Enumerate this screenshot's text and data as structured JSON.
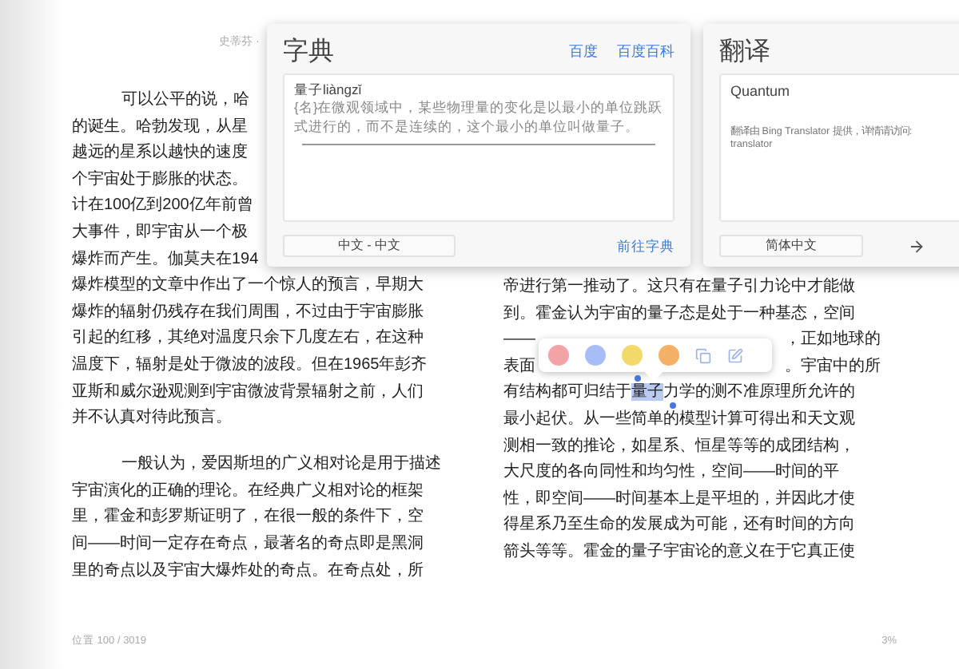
{
  "header": {
    "title": "史蒂芬 ·"
  },
  "left_column": {
    "paragraphs": [
      {
        "indent": true,
        "lines": [
          "可以公平的说，哈",
          "的诞生。哈勃发现，从星",
          "越远的星系以越快的速度",
          "个宇宙处于膨胀的状态。",
          "计在100亿到200亿年前曾",
          "大事件，即宇宙从一个极",
          "爆炸而产生。伽莫夫在194",
          "爆炸模型的文章中作出了一个惊人的预言，早期大",
          "爆炸的辐射仍残存在我们周围，不过由于宇宙膨胀",
          "引起的红移，其绝对温度只余下几度左右，在这种",
          "温度下，辐射是处于微波的波段。但在1965年彭齐",
          "亚斯和威尔逊观测到宇宙微波背景辐射之前，人们",
          "并不认真对待此预言。"
        ]
      },
      {
        "indent": true,
        "lines": [
          "一般认为，爱因斯坦的广义相对论是用于描述",
          "宇宙演化的正确的理论。在经典广义相对论的框架",
          "里，霍金和彭罗斯证明了，在很一般的条件下，空",
          "间——时间一定存在奇点，最著名的奇点即是黑洞",
          "里的奇点以及宇宙大爆炸处的奇点。在奇点处，所"
        ]
      }
    ]
  },
  "right_column": {
    "lines": [
      {
        "kind": "plain",
        "text": "帝进行第一推动了。这只有在量子引力论中才能做"
      },
      {
        "kind": "plain",
        "text": "到。霍金认为宇宙的量子态是处于一种基态，空间"
      },
      {
        "kind": "split",
        "left": "——",
        "right": "，正如地球的"
      },
      {
        "kind": "split",
        "left": "表面",
        "right": "。宇宙中的所"
      },
      {
        "kind": "selection",
        "before": "有结构都可归结于",
        "selected": "量子",
        "after": "力学的测不准原理所允许的"
      },
      {
        "kind": "plain",
        "text": "最小起伏。从一些简单的模型计算可得出和天文观"
      },
      {
        "kind": "plain",
        "text": "测相一致的推论，如星系、恒星等等的成团结构，"
      },
      {
        "kind": "plain",
        "text": "大尺度的各向同性和均匀性，空间——时间的平"
      },
      {
        "kind": "plain",
        "text": "性，即空间——时间基本上是平坦的，并因此才使"
      },
      {
        "kind": "plain",
        "text": "得星系乃至生命的发展成为可能，还有时间的方向"
      },
      {
        "kind": "plain",
        "text": "箭头等等。霍金的量子宇宙论的意义在于它真正使"
      }
    ]
  },
  "dictionary_panel": {
    "title": "字典",
    "links": [
      "百度",
      "百度百科"
    ],
    "headword": "量子liàngzǐ",
    "definition": "{名}在微观领域中，某些物理量的变化是以最小的单位跳跃式进行的，而不是连续的，这个最小的单位叫做量子。",
    "language_button": "中文 - 中文",
    "goto_link": "前往字典"
  },
  "translation_panel": {
    "title": "翻译",
    "result": "Quantum",
    "credit": "翻译由 Bing Translator 提供，详情请访问:",
    "credit_link": "translator",
    "language_button": "简体中文"
  },
  "highlight_toolbar": {
    "colors": [
      {
        "color": "#f2a3a6"
      },
      {
        "color": "#a6bdf5"
      },
      {
        "color": "#f3d96a"
      },
      {
        "color": "#f3b066"
      }
    ]
  },
  "footer": {
    "location": "位置 100 / 3019",
    "progress": "3%"
  }
}
